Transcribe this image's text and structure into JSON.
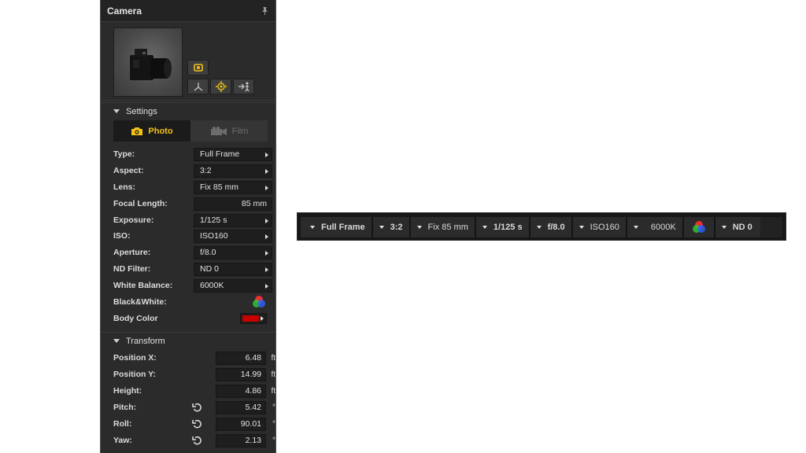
{
  "panel": {
    "title": "Camera",
    "settings_section": "Settings",
    "transform_section": "Transform",
    "tabs": [
      {
        "label": "Photo",
        "active": true
      },
      {
        "label": "Film",
        "active": false
      }
    ],
    "settings": [
      {
        "label": "Type:",
        "value": "Full Frame",
        "kind": "dropdown"
      },
      {
        "label": "Aspect:",
        "value": "3:2",
        "kind": "dropdown"
      },
      {
        "label": "Lens:",
        "value": "Fix 85 mm",
        "kind": "dropdown"
      },
      {
        "label": "Focal Length:",
        "value": "85 mm",
        "kind": "number"
      },
      {
        "label": "Exposure:",
        "value": "1/125 s",
        "kind": "dropdown"
      },
      {
        "label": "ISO:",
        "value": "ISO160",
        "kind": "dropdown"
      },
      {
        "label": "Aperture:",
        "value": "f/8.0",
        "kind": "dropdown"
      },
      {
        "label": "ND Filter:",
        "value": "ND 0",
        "kind": "dropdown"
      },
      {
        "label": "White Balance:",
        "value": "6000K",
        "kind": "dropdown"
      }
    ],
    "bw_label": "Black&White:",
    "body_color_label": "Body Color",
    "body_color": "#c80000",
    "transform": [
      {
        "label": "Position X:",
        "value": "6.48",
        "unit": "ft",
        "reset": false
      },
      {
        "label": "Position Y:",
        "value": "14.99",
        "unit": "ft",
        "reset": false
      },
      {
        "label": "Height:",
        "value": "4.86",
        "unit": "ft",
        "reset": false
      },
      {
        "label": "Pitch:",
        "value": "5.42",
        "unit": "°",
        "reset": true
      },
      {
        "label": "Roll:",
        "value": "90.01",
        "unit": "°",
        "reset": true
      },
      {
        "label": "Yaw:",
        "value": "2.13",
        "unit": "°",
        "reset": true
      }
    ]
  },
  "toolbar": {
    "type": "Full Frame",
    "aspect": "3:2",
    "lens": "Fix 85 mm",
    "exposure": "1/125 s",
    "aperture": "f/8.0",
    "iso": "ISO160",
    "white_balance": "6000K",
    "nd": "ND 0"
  },
  "colors": {
    "accent": "#f2c21a",
    "panel_bg": "#2b2b2b",
    "field_bg": "#1e1e1e"
  }
}
